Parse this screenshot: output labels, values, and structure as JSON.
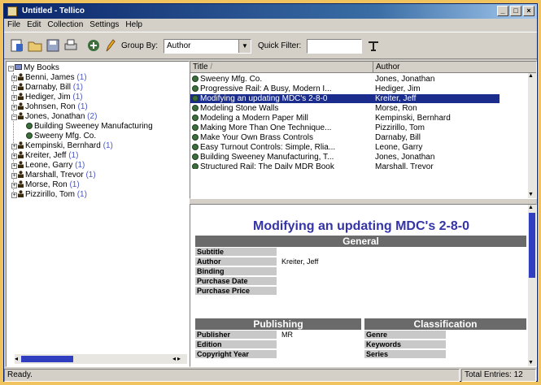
{
  "window": {
    "title": "Untitled - Tellico"
  },
  "menu": [
    "File",
    "Edit",
    "Collection",
    "Settings",
    "Help"
  ],
  "toolbar": {
    "group_by_label": "Group By:",
    "group_by_value": "Author",
    "quick_filter_label": "Quick Filter:",
    "quick_filter_value": ""
  },
  "tree": {
    "root": "My Books",
    "items": [
      {
        "label": "Benni, James",
        "count": "(1)"
      },
      {
        "label": "Darnaby, Bill",
        "count": "(1)"
      },
      {
        "label": "Hediger, Jim",
        "count": "(1)"
      },
      {
        "label": "Johnsen, Ron",
        "count": "(1)"
      },
      {
        "label": "Jones, Jonathan",
        "count": "(2)"
      },
      {
        "label": "Kempinski, Bernhard",
        "count": "(1)"
      },
      {
        "label": "Kreiter, Jeff",
        "count": "(1)"
      },
      {
        "label": "Leone, Garry",
        "count": "(1)"
      },
      {
        "label": "Marshall, Trevor",
        "count": "(1)"
      },
      {
        "label": "Morse, Ron",
        "count": "(1)"
      },
      {
        "label": "Pizzirillo, Tom",
        "count": "(1)"
      }
    ],
    "children": [
      "Building Sweeney Manufacturing",
      "Sweeny Mfg. Co."
    ]
  },
  "list": {
    "columns": [
      "Title",
      "Author"
    ],
    "rows": [
      {
        "title": "Sweeny Mfg. Co.",
        "author": "Jones, Jonathan"
      },
      {
        "title": "Progressive Rail: A Busy, Modern I...",
        "author": "Hediger, Jim"
      },
      {
        "title": "Modifying an updating MDC's 2-8-0",
        "author": "Kreiter, Jeff"
      },
      {
        "title": "Modeling Stone Walls",
        "author": "Morse, Ron"
      },
      {
        "title": "Modeling a Modern Paper Mill",
        "author": "Kempinski, Bernhard"
      },
      {
        "title": "Making More Than One Technique...",
        "author": "Pizzirillo, Tom"
      },
      {
        "title": "Make Your Own Brass Controls",
        "author": "Darnaby, Bill"
      },
      {
        "title": "Easy Turnout Controls: Simple, Rlia...",
        "author": "Leone, Garry"
      },
      {
        "title": "Building Sweeney Manufacturing, T...",
        "author": "Jones, Jonathan"
      },
      {
        "title": "Structured Rail: The Daily MDR Book",
        "author": "Marshall, Trevor"
      }
    ]
  },
  "details": {
    "title": "Modifying an updating MDC's 2-8-0",
    "general_header": "General",
    "general": [
      {
        "label": "Subtitle",
        "value": ""
      },
      {
        "label": "Author",
        "value": "Kreiter, Jeff"
      },
      {
        "label": "Binding",
        "value": ""
      },
      {
        "label": "Purchase Date",
        "value": ""
      },
      {
        "label": "Purchase Price",
        "value": ""
      }
    ],
    "publishing_header": "Publishing",
    "publishing": [
      {
        "label": "Publisher",
        "value": "MR"
      },
      {
        "label": "Edition",
        "value": ""
      },
      {
        "label": "Copyright Year",
        "value": ""
      }
    ],
    "classification_header": "Classification",
    "classification": [
      "Genre",
      "Keywords",
      "Series"
    ]
  },
  "status": {
    "left": "Ready.",
    "right": "Total Entries: 12"
  },
  "colors": {
    "selection": "#1a2d8c",
    "title_blue": "#3434a8",
    "desktop": "#f1c35e"
  }
}
